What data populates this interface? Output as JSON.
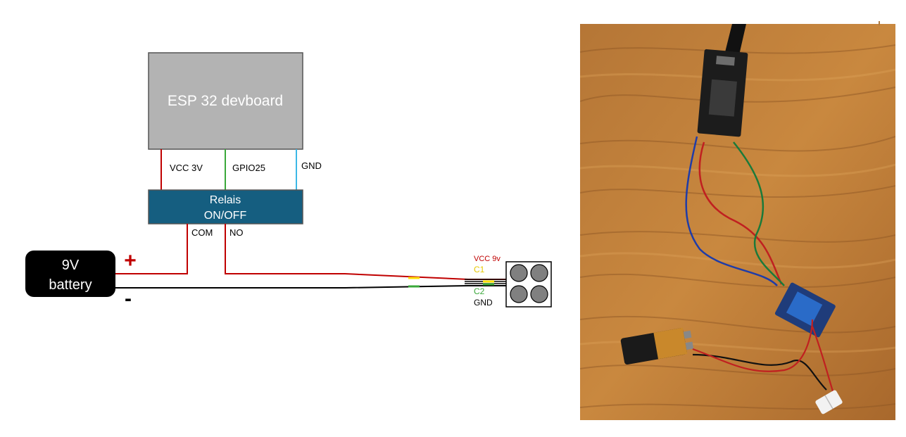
{
  "esp": {
    "label": "ESP 32 devboard"
  },
  "relay": {
    "line1": "Relais",
    "line2": "ON/OFF"
  },
  "battery": {
    "line1": "9V",
    "line2": "battery",
    "plus": "+",
    "minus": "-"
  },
  "wires": {
    "vcc": "VCC 3V",
    "gpio": "GPIO25",
    "gnd": "GND",
    "com": "COM",
    "no": "NO"
  },
  "sensor": {
    "vcc": "VCC 9v",
    "c1": "C1",
    "c2": "C2",
    "gnd": "GND"
  },
  "colors": {
    "esp_fill": "#b3b3b3",
    "relay_fill": "#155e80",
    "battery_fill": "#000000",
    "red": "#c00000",
    "green": "#3aa83a",
    "blue": "#3cb8e6",
    "yellow": "#ffe000"
  }
}
